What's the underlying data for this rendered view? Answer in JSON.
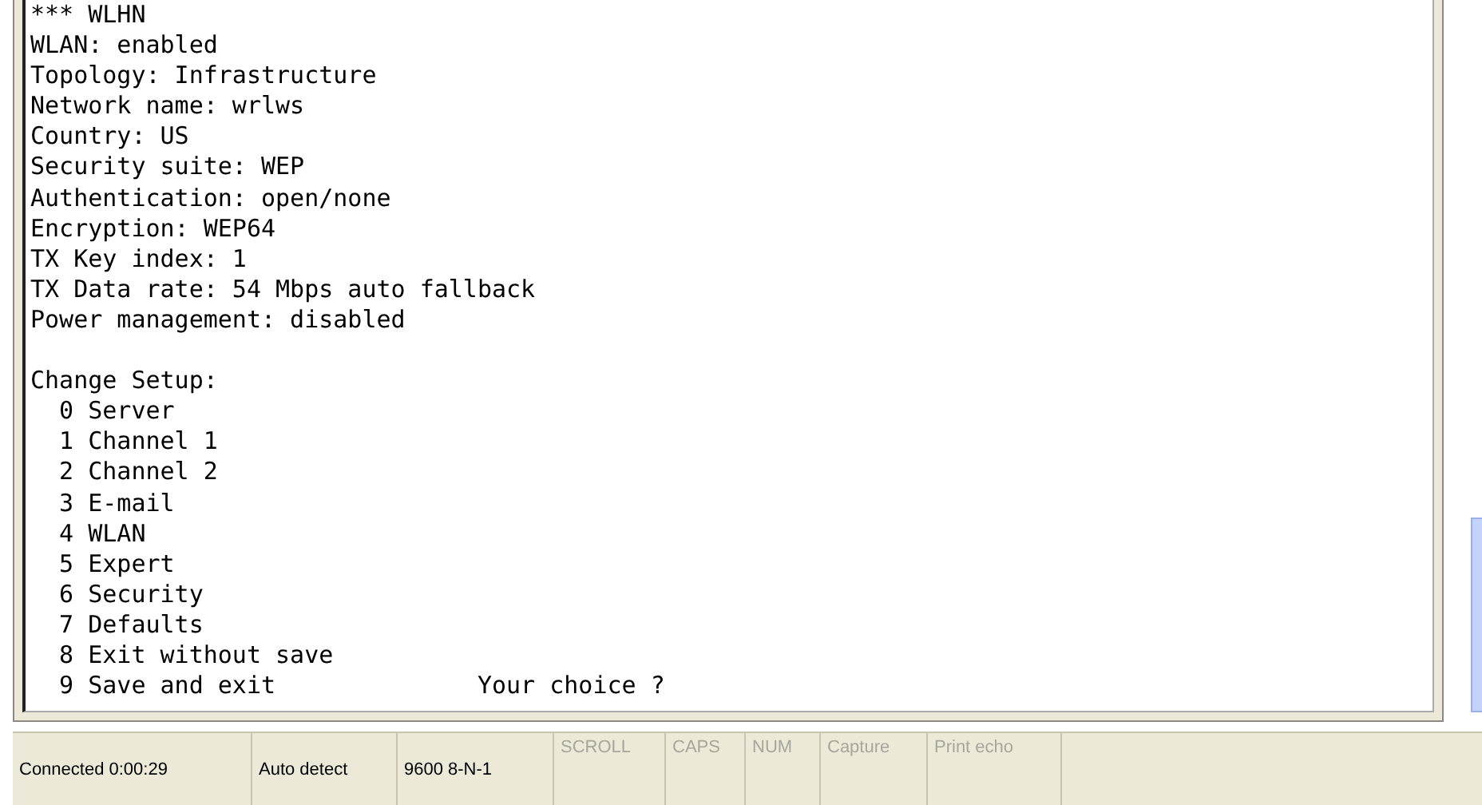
{
  "terminal": {
    "settings": [
      "*** WLHN",
      "WLAN: enabled",
      "Topology: Infrastructure",
      "Network name: wrlws",
      "Country: US",
      "Security suite: WEP",
      "Authentication: open/none",
      "Encryption: WEP64",
      "TX Key index: 1",
      "TX Data rate: 54 Mbps auto fallback",
      "Power management: disabled"
    ],
    "menu": [
      "Change Setup:",
      "  0 Server",
      "  1 Channel 1",
      "  2 Channel 2",
      "  3 E-mail",
      "  4 WLAN",
      "  5 Expert",
      "  6 Security",
      "  7 Defaults",
      "  8 Exit without save",
      "  9 Save and exit              Your choice ?"
    ]
  },
  "status_bar": [
    {
      "text": "Connected 0:00:29",
      "disabled": false
    },
    {
      "text": "Auto detect",
      "disabled": false
    },
    {
      "text": "9600 8-N-1",
      "disabled": false
    },
    {
      "text": "SCROLL",
      "disabled": true
    },
    {
      "text": "CAPS",
      "disabled": true
    },
    {
      "text": "NUM",
      "disabled": true
    },
    {
      "text": "Capture",
      "disabled": true
    },
    {
      "text": "Print echo",
      "disabled": true
    }
  ]
}
